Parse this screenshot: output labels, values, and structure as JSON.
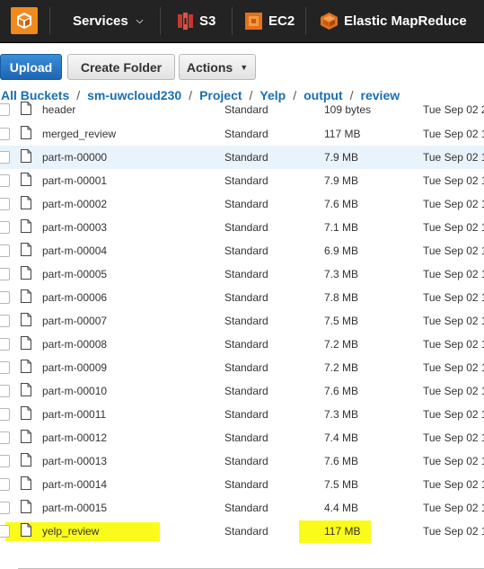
{
  "nav": {
    "services_label": "Services",
    "items": [
      {
        "label": "S3",
        "icon": "s3-icon"
      },
      {
        "label": "EC2",
        "icon": "ec2-icon"
      },
      {
        "label": "Elastic MapReduce",
        "icon": "emr-icon"
      }
    ]
  },
  "toolbar": {
    "upload_label": "Upload",
    "create_folder_label": "Create Folder",
    "actions_label": "Actions"
  },
  "breadcrumb": [
    "All Buckets",
    "sm-uwcloud230",
    "Project",
    "Yelp",
    "output",
    "review"
  ],
  "files": [
    {
      "name": "header",
      "storage": "Standard",
      "size": "109 bytes",
      "modified": "Tue Sep 02 2"
    },
    {
      "name": "merged_review",
      "storage": "Standard",
      "size": "117 MB",
      "modified": "Tue Sep 02 1"
    },
    {
      "name": "part-m-00000",
      "storage": "Standard",
      "size": "7.9 MB",
      "modified": "Tue Sep 02 1",
      "selected": true
    },
    {
      "name": "part-m-00001",
      "storage": "Standard",
      "size": "7.9 MB",
      "modified": "Tue Sep 02 1"
    },
    {
      "name": "part-m-00002",
      "storage": "Standard",
      "size": "7.6 MB",
      "modified": "Tue Sep 02 1"
    },
    {
      "name": "part-m-00003",
      "storage": "Standard",
      "size": "7.1 MB",
      "modified": "Tue Sep 02 1"
    },
    {
      "name": "part-m-00004",
      "storage": "Standard",
      "size": "6.9 MB",
      "modified": "Tue Sep 02 1"
    },
    {
      "name": "part-m-00005",
      "storage": "Standard",
      "size": "7.3 MB",
      "modified": "Tue Sep 02 1"
    },
    {
      "name": "part-m-00006",
      "storage": "Standard",
      "size": "7.8 MB",
      "modified": "Tue Sep 02 1"
    },
    {
      "name": "part-m-00007",
      "storage": "Standard",
      "size": "7.5 MB",
      "modified": "Tue Sep 02 1"
    },
    {
      "name": "part-m-00008",
      "storage": "Standard",
      "size": "7.2 MB",
      "modified": "Tue Sep 02 1"
    },
    {
      "name": "part-m-00009",
      "storage": "Standard",
      "size": "7.2 MB",
      "modified": "Tue Sep 02 1"
    },
    {
      "name": "part-m-00010",
      "storage": "Standard",
      "size": "7.6 MB",
      "modified": "Tue Sep 02 1"
    },
    {
      "name": "part-m-00011",
      "storage": "Standard",
      "size": "7.3 MB",
      "modified": "Tue Sep 02 1"
    },
    {
      "name": "part-m-00012",
      "storage": "Standard",
      "size": "7.4 MB",
      "modified": "Tue Sep 02 1"
    },
    {
      "name": "part-m-00013",
      "storage": "Standard",
      "size": "7.6 MB",
      "modified": "Tue Sep 02 1"
    },
    {
      "name": "part-m-00014",
      "storage": "Standard",
      "size": "7.5 MB",
      "modified": "Tue Sep 02 1"
    },
    {
      "name": "part-m-00015",
      "storage": "Standard",
      "size": "4.4 MB",
      "modified": "Tue Sep 02 1"
    },
    {
      "name": "yelp_review",
      "storage": "Standard",
      "size": "117 MB",
      "modified": "Tue Sep 02 1",
      "highlighted": true
    }
  ],
  "colors": {
    "nav_bg": "#232323",
    "link_blue": "#1a6fb5",
    "primary_button": "#2672c2",
    "highlight_yellow": "#fbfb1a",
    "selected_row": "#e9f3fb"
  }
}
